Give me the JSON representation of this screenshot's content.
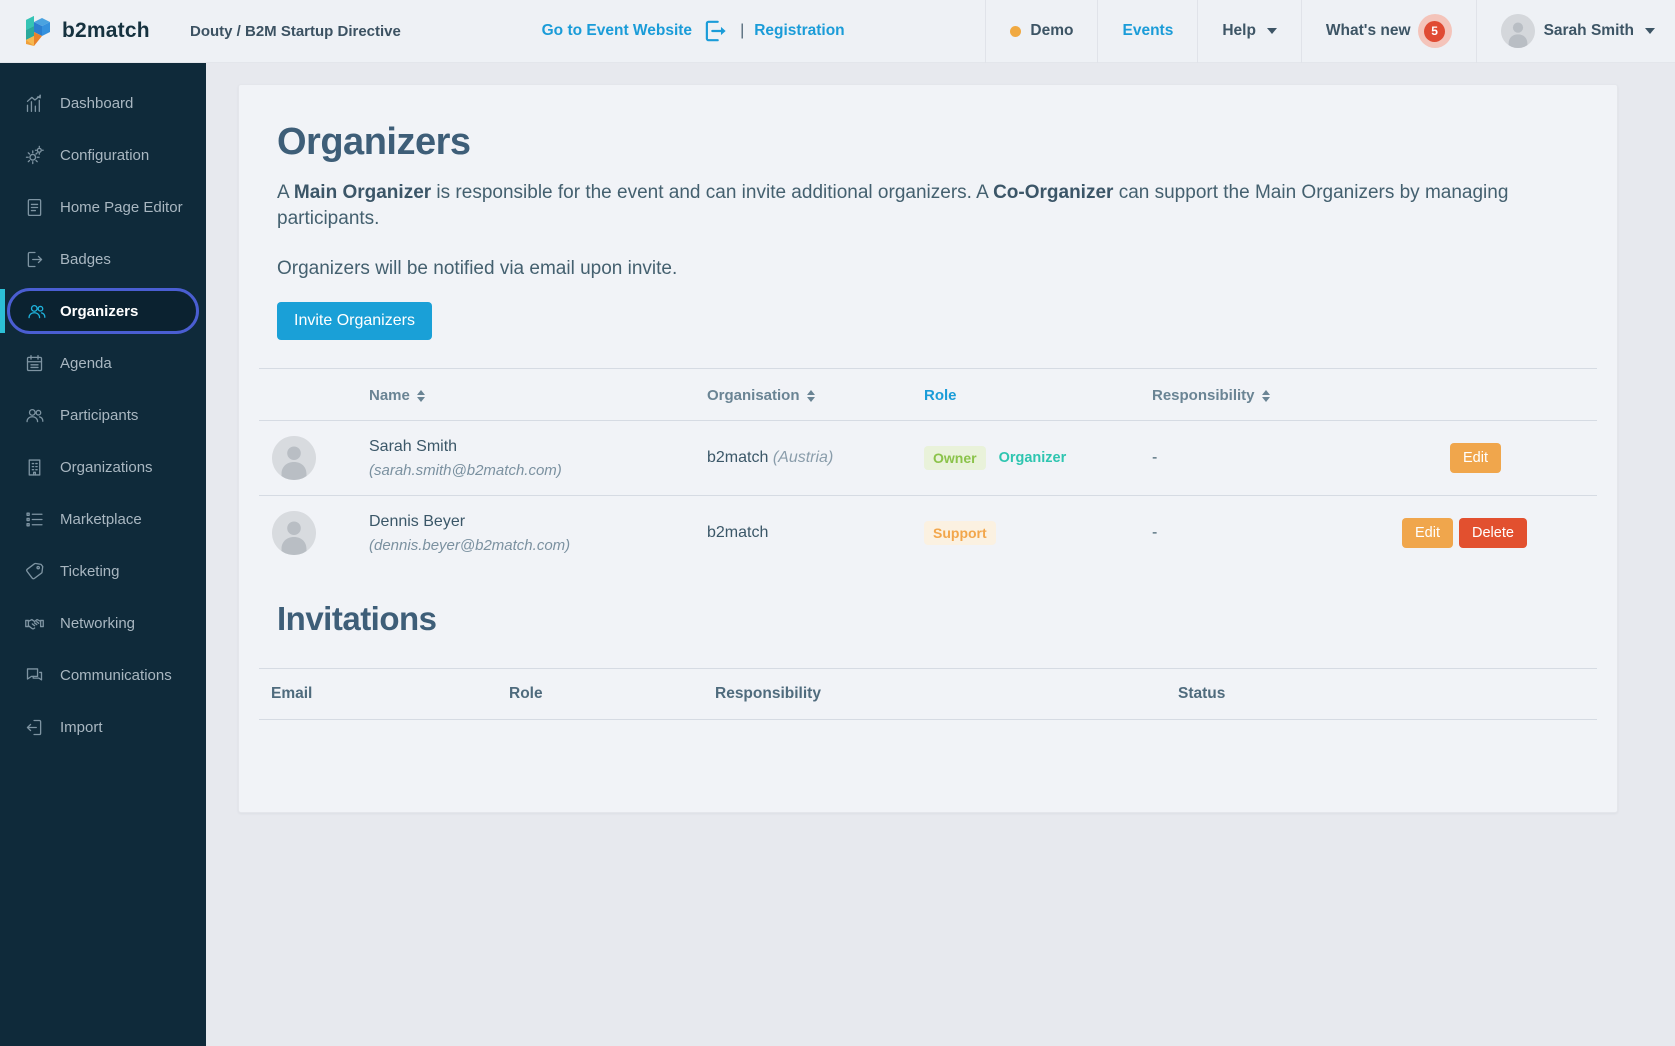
{
  "header": {
    "logo_text": "b2match",
    "breadcrumb": "Douty / B2M Startup Directive",
    "event_website_link": "Go to Event Website",
    "separator": "|",
    "registration_link": "Registration",
    "demo_label": "Demo",
    "events_link": "Events",
    "help_label": "Help",
    "whats_new_label": "What's new",
    "whats_new_count": "5",
    "user_name": "Sarah Smith"
  },
  "sidebar": {
    "items": [
      {
        "label": "Dashboard",
        "icon": "bar-chart-icon",
        "active": false
      },
      {
        "label": "Configuration",
        "icon": "gear-icon",
        "active": false
      },
      {
        "label": "Home Page Editor",
        "icon": "document-icon",
        "active": false
      },
      {
        "label": "Badges",
        "icon": "badge-export-icon",
        "active": false
      },
      {
        "label": "Organizers",
        "icon": "people-icon",
        "active": true
      },
      {
        "label": "Agenda",
        "icon": "calendar-icon",
        "active": false
      },
      {
        "label": "Participants",
        "icon": "people-icon",
        "active": false
      },
      {
        "label": "Organizations",
        "icon": "building-icon",
        "active": false
      },
      {
        "label": "Marketplace",
        "icon": "list-icon",
        "active": false
      },
      {
        "label": "Ticketing",
        "icon": "tag-icon",
        "active": false
      },
      {
        "label": "Networking",
        "icon": "handshake-icon",
        "active": false
      },
      {
        "label": "Communications",
        "icon": "chat-icon",
        "active": false
      },
      {
        "label": "Import",
        "icon": "import-icon",
        "active": false
      }
    ]
  },
  "main": {
    "title": "Organizers",
    "description": {
      "p1": "A ",
      "b1": "Main Organizer",
      "p2": " is responsible for the event and can invite additional organizers. A ",
      "b2": "Co-Organizer",
      "p3": " can support the Main Organizers by managing participants."
    },
    "notify_text": "Organizers will be notified via email upon invite.",
    "invite_button": "Invite Organizers",
    "organizers_table": {
      "headers": [
        {
          "label": "Name",
          "sortable": true
        },
        {
          "label": "Organisation",
          "sortable": true
        },
        {
          "label": "Role",
          "sortable": false
        },
        {
          "label": "Responsibility",
          "sortable": true
        }
      ],
      "rows": [
        {
          "name": "Sarah Smith",
          "email": "(sarah.smith@b2match.com)",
          "organisation": "b2match",
          "org_note": "(Austria)",
          "role_badge": "Owner",
          "role_extra": "Organizer",
          "responsibility": "-",
          "actions": [
            "Edit"
          ]
        },
        {
          "name": "Dennis Beyer",
          "email": "(dennis.beyer@b2match.com)",
          "organisation": "b2match",
          "org_note": "",
          "role_badge": "Support",
          "role_extra": "",
          "responsibility": "-",
          "actions": [
            "Edit",
            "Delete"
          ]
        }
      ]
    },
    "invitations": {
      "title": "Invitations",
      "headers": [
        "Email",
        "Role",
        "Responsibility",
        "Status"
      ]
    }
  },
  "colors": {
    "accent_blue": "#1a9fd6",
    "link_blue": "#1a9cd8",
    "sidebar_bg": "#0f2a3a",
    "active_ring_blue": "#4a5ed2",
    "active_accent_cyan": "#2cc0d6",
    "owner_green": "#8bc34a",
    "organizer_teal": "#2ec5b0",
    "support_orange": "#f2a64b",
    "edit_amber": "#f0a64c",
    "delete_red": "#e2502f",
    "demo_dot_orange": "#f0a941",
    "notification_red": "#e04b33"
  }
}
